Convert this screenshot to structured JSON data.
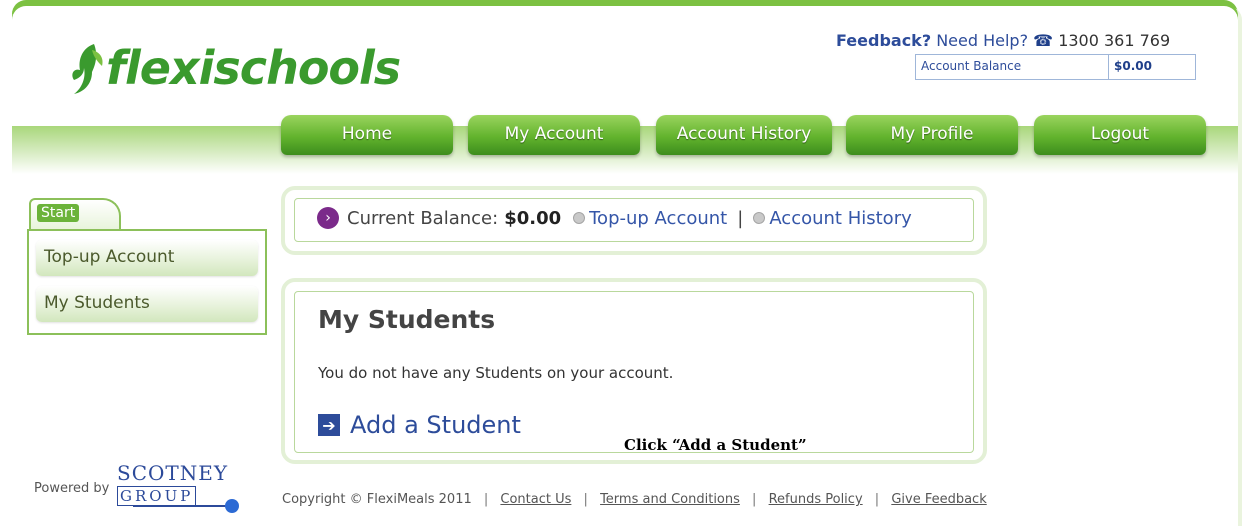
{
  "brand": {
    "logo_text": "flexischools"
  },
  "header": {
    "feedback_label": "Feedback?",
    "help_label": "Need Help?",
    "phone": "1300 361 769",
    "phone_icon": "telephone-icon",
    "account_balance_label": "Account Balance",
    "account_balance_value": "$0.00"
  },
  "nav": {
    "tabs": [
      {
        "label": "Home"
      },
      {
        "label": "My Account"
      },
      {
        "label": "Account History"
      },
      {
        "label": "My Profile"
      },
      {
        "label": "Logout"
      }
    ]
  },
  "sidebar": {
    "start_label": "Start",
    "items": [
      {
        "label": "Top-up Account"
      },
      {
        "label": "My Students"
      }
    ]
  },
  "balance_bar": {
    "label": "Current Balance:",
    "value": "$0.00",
    "topup_link": "Top-up Account",
    "separator": "|",
    "history_link": "Account History"
  },
  "main": {
    "title": "My Students",
    "message": "You do not have any Students on your account.",
    "add_student_label": "Add a Student"
  },
  "annotation": {
    "text": "Click “Add a Student”"
  },
  "powered": {
    "label": "Powered by",
    "brand_top": "SCOTNEY",
    "brand_bottom": "GROUP"
  },
  "footer": {
    "copyright": "Copyright © FlexiMeals 2011",
    "links": [
      {
        "label": "Contact Us"
      },
      {
        "label": "Terms and Conditions"
      },
      {
        "label": "Refunds Policy"
      },
      {
        "label": "Give Feedback"
      }
    ]
  },
  "colors": {
    "brand_green": "#7cc142",
    "link_blue": "#2d4c9a",
    "arrow_purple": "#7b2a8a"
  }
}
